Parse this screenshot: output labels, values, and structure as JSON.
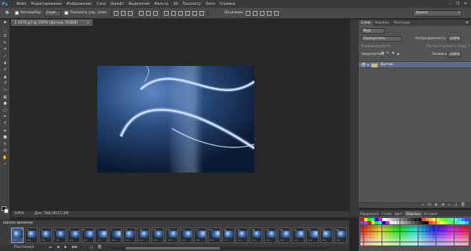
{
  "menubar": {
    "logo": "Ps",
    "items": [
      "Файл",
      "Редактирование",
      "Изображение",
      "Слои",
      "Шрифт",
      "Выделение",
      "Фильтр",
      "3D",
      "Просмотр",
      "Окно",
      "Справка"
    ],
    "minimize": "–",
    "restore": "❐",
    "close": "✕"
  },
  "options": {
    "autoselect_label": "Автовыбор:",
    "autoselect_value": "Слой",
    "show_transform_label": "Показать упр. элем.",
    "mode_3d": "3D-режим:",
    "workspace": "Ирина"
  },
  "document": {
    "tab_title": "1-1076.gif @ 100% (футаж, RGB/8)",
    "tab_close": "×",
    "zoom": "100%",
    "doc_info": "Док: 568,5K/17,2M"
  },
  "layers": {
    "tabs": [
      "Слои",
      "Каналы",
      "Контуры"
    ],
    "menu": "≡",
    "kind_label": "Вид",
    "blend_mode": "Пропустить",
    "opacity_label": "Непрозрачность:",
    "opacity_value": "100%",
    "unify_label": "Унифицировать:",
    "propagate_label": "Распространить кадр 1",
    "lock_label": "Закрепить:",
    "fill_label": "Заливка:",
    "fill_value": "100%",
    "group": {
      "name": "футаж",
      "visible": true
    }
  },
  "swatches": {
    "tabs": [
      "Коррекция",
      "Стили",
      "Цвет",
      "Образцы",
      "История"
    ],
    "active_tab": "Образцы"
  },
  "timeline": {
    "title": "Шкала времени",
    "loop": "Постоянно",
    "frame_times": [
      "0,1",
      "0,1",
      "0,1",
      "0,1",
      "0,1",
      "0,1",
      "0,1",
      "0,1",
      "0,1",
      "0,1",
      "0,1",
      "0,1",
      "0,1",
      "0,1",
      "0,1",
      "0,1",
      "0,1",
      "0,1",
      "0,1",
      "0,1",
      "0,1",
      "0,1",
      "0,1",
      "0,1"
    ],
    "selected_frame": 1
  },
  "colors": {
    "accent": "#31a8ff",
    "selection": "#5a6f8f",
    "foreground": "#000000",
    "background": "#ffffff"
  }
}
